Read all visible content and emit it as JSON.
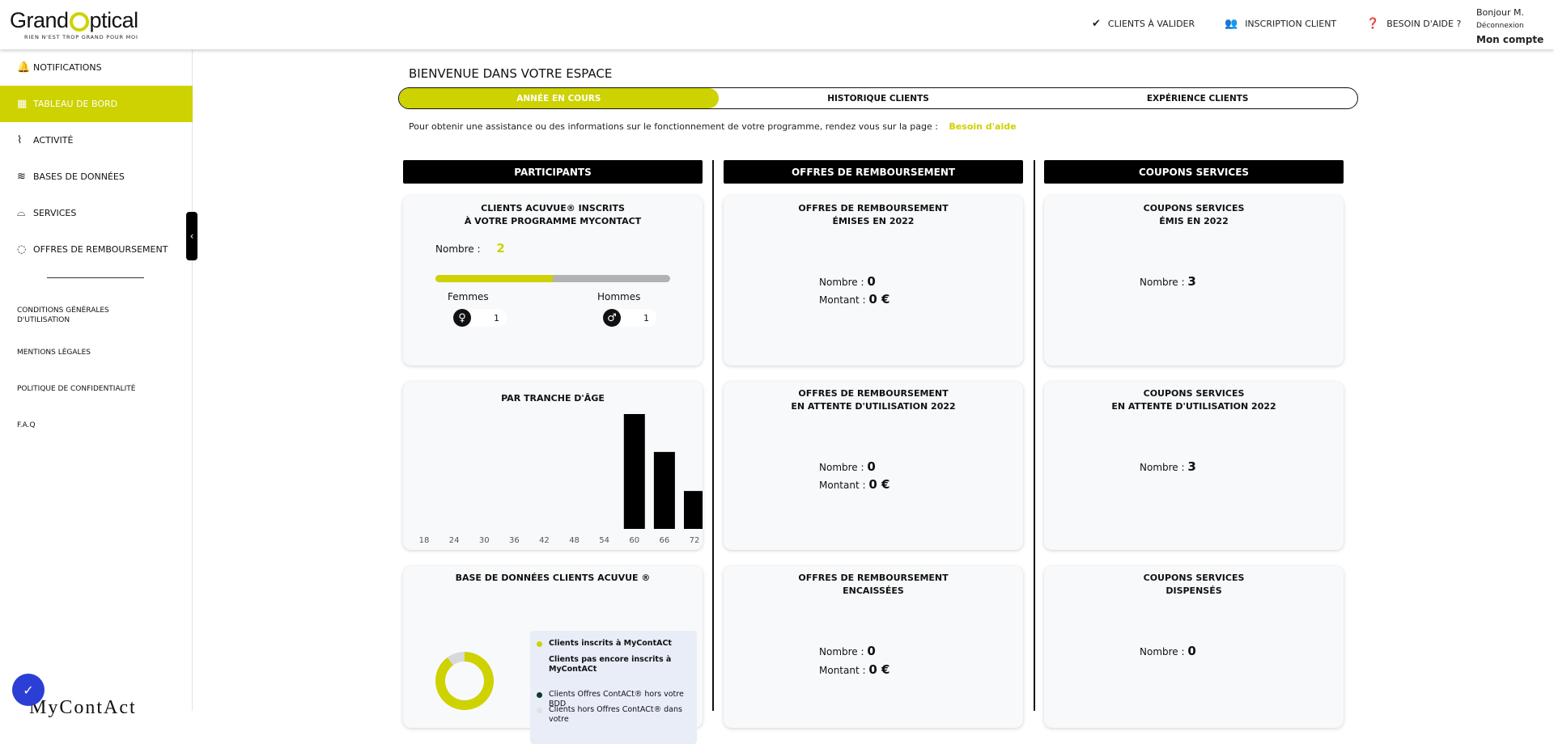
{
  "brand": {
    "name_pre": "Grand",
    "name_post": "ptical",
    "tagline": "RIEN N'EST TROP GRAND POUR MOI"
  },
  "topnav": {
    "clients": "CLIENTS À VALIDER",
    "inscription": "INSCRIPTION CLIENT",
    "help": "BESOIN D'AIDE ?"
  },
  "account": {
    "hello": "Bonjour M.",
    "logout": "Déconnexion",
    "my_account": "Mon compte"
  },
  "sidebar": {
    "items": [
      {
        "label": "NOTIFICATIONS",
        "icon": "bell-icon"
      },
      {
        "label": "TABLEAU DE BORD",
        "icon": "grid-icon"
      },
      {
        "label": "ACTIVITÉ",
        "icon": "activity-icon"
      },
      {
        "label": "BASES DE DONNÉES",
        "icon": "database-icon"
      },
      {
        "label": "SERVICES",
        "icon": "services-icon"
      },
      {
        "label": "OFFRES DE REMBOURSEMENT",
        "icon": "refund-icon"
      }
    ],
    "links": [
      "CONDITIONS GÉNÉRALES D'UTILISATION",
      "MENTIONS LÉGALES",
      "POLITIQUE DE CONFIDENTIALITÉ",
      "F.A.Q"
    ],
    "bottom_logo": "MyContAct"
  },
  "main": {
    "welcome": "BIENVENUE DANS VOTRE ESPACE",
    "tabs": [
      "ANNÉE EN COURS",
      "HISTORIQUE CLIENTS",
      "EXPÉRIENCE CLIENTS"
    ],
    "info": "Pour obtenir une assistance ou des informations sur le fonctionnement de votre programme, rendez vous sur la page :",
    "info_link": "Besoin d'aide",
    "columns": [
      "PARTICIPANTS",
      "OFFRES DE REMBOURSEMENT",
      "COUPONS SERVICES"
    ]
  },
  "participants": {
    "title1": "CLIENTS ACUVUE® INSCRITS",
    "title2": "À VOTRE PROGRAMME MYCONTACT",
    "nombre_label": "Nombre :",
    "nombre": "2",
    "gauge_women_fraction": 0.5,
    "women_label": "Femmes",
    "men_label": "Hommes",
    "women": "1",
    "men": "1"
  },
  "age": {
    "title": "PAR TRANCHE D'ÂGE"
  },
  "bdd": {
    "title": "BASE DE DONNÉES CLIENTS ACUVUE ®",
    "legend": [
      {
        "label": "Clients inscrits à MyContACt",
        "color": "#cdd200"
      },
      {
        "label": "Clients pas encore inscrits à MyContACt",
        "color": "#d8d8d8"
      },
      {
        "label": "Clients Offres ContACt® hors votre BDD",
        "color": "#0a3b2a"
      },
      {
        "label": "Clients hors Offres ContACt® dans votre",
        "color": "#f0f0f0"
      }
    ]
  },
  "offres": {
    "c1": {
      "t1": "OFFRES DE REMBOURSEMENT",
      "t2": "ÉMISES EN 2022",
      "nombre_label": "Nombre :",
      "nombre": "0",
      "montant_label": "Montant :",
      "montant": "0 €"
    },
    "c2": {
      "t1": "OFFRES DE REMBOURSEMENT",
      "t2": "EN ATTENTE D'UTILISATION 2022",
      "nombre_label": "Nombre :",
      "nombre": "0",
      "montant_label": "Montant :",
      "montant": "0 €"
    },
    "c3": {
      "t1": "OFFRES DE REMBOURSEMENT",
      "t2": "ENCAISSÉES",
      "nombre_label": "Nombre :",
      "nombre": "0",
      "montant_label": "Montant :",
      "montant": "0 €"
    }
  },
  "coupons": {
    "c1": {
      "t1": "COUPONS SERVICES",
      "t2": "ÉMIS EN 2022",
      "nombre_label": "Nombre :",
      "nombre": "3"
    },
    "c2": {
      "t1": "COUPONS SERVICES",
      "t2": "EN ATTENTE D'UTILISATION 2022",
      "nombre_label": "Nombre :",
      "nombre": "3"
    },
    "c3": {
      "t1": "COUPONS SERVICES",
      "t2": "DISPENSÉS",
      "nombre_label": "Nombre :",
      "nombre": "0"
    }
  },
  "colors": {
    "accent": "#cdd200",
    "fab": "#2b3ed6"
  },
  "chart_data": [
    {
      "type": "bar",
      "title": "PAR TRANCHE D'ÂGE",
      "categories": [
        "18",
        "24",
        "30",
        "36",
        "42",
        "48",
        "54",
        "60",
        "66",
        "72"
      ],
      "values": [
        0,
        0,
        0,
        0,
        0,
        0,
        0,
        1.0,
        0.67,
        0.33
      ],
      "ylim": [
        0,
        1
      ],
      "grid": false
    },
    {
      "type": "pie",
      "title": "BASE DE DONNÉES CLIENTS ACUVUE ®",
      "categories": [
        "Clients inscrits à MyContACt",
        "Clients pas encore inscrits à MyContACt"
      ],
      "values": [
        90,
        10
      ]
    }
  ]
}
